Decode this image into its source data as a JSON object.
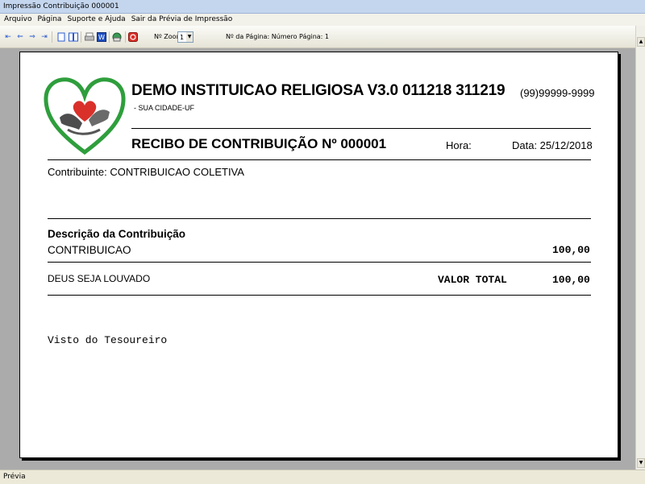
{
  "window": {
    "title": "Impressão Contribuição 000001"
  },
  "menu": [
    {
      "label": "Arquivo"
    },
    {
      "label": "Página"
    },
    {
      "label": "Suporte e Ajuda"
    },
    {
      "label": "Sair da Prévia de Impressão"
    }
  ],
  "toolbar": {
    "zoom_label": "Nº Zoom",
    "zoom_value": "1",
    "page_info": "Nº da Página: Número Página: 1"
  },
  "receipt": {
    "org_name": "DEMO INSTITUICAO RELIGIOSA V3.0 011218 311219",
    "org_city": "- SUA CIDADE-UF",
    "org_phone": "(99)99999-9999",
    "title": "RECIBO DE CONTRIBUIÇÃO Nº 000001",
    "hora_label": "Hora:",
    "data_label": "Data: 25/12/2018",
    "contribuinte": "Contribuinte: CONTRIBUICAO COLETIVA",
    "desc_title": "Descrição da Contribuição",
    "desc_item": "CONTRIBUICAO",
    "desc_value": "100,00",
    "footer_msg": "DEUS SEJA LOUVADO",
    "total_label": "VALOR TOTAL",
    "total_value": "100,00",
    "visto": "Visto do Tesoureiro"
  },
  "status": {
    "text": "Prévia"
  },
  "colors": {
    "accent": "#2a5bd0",
    "logo_green": "#2e9e3c",
    "logo_heart": "#d9302a"
  }
}
